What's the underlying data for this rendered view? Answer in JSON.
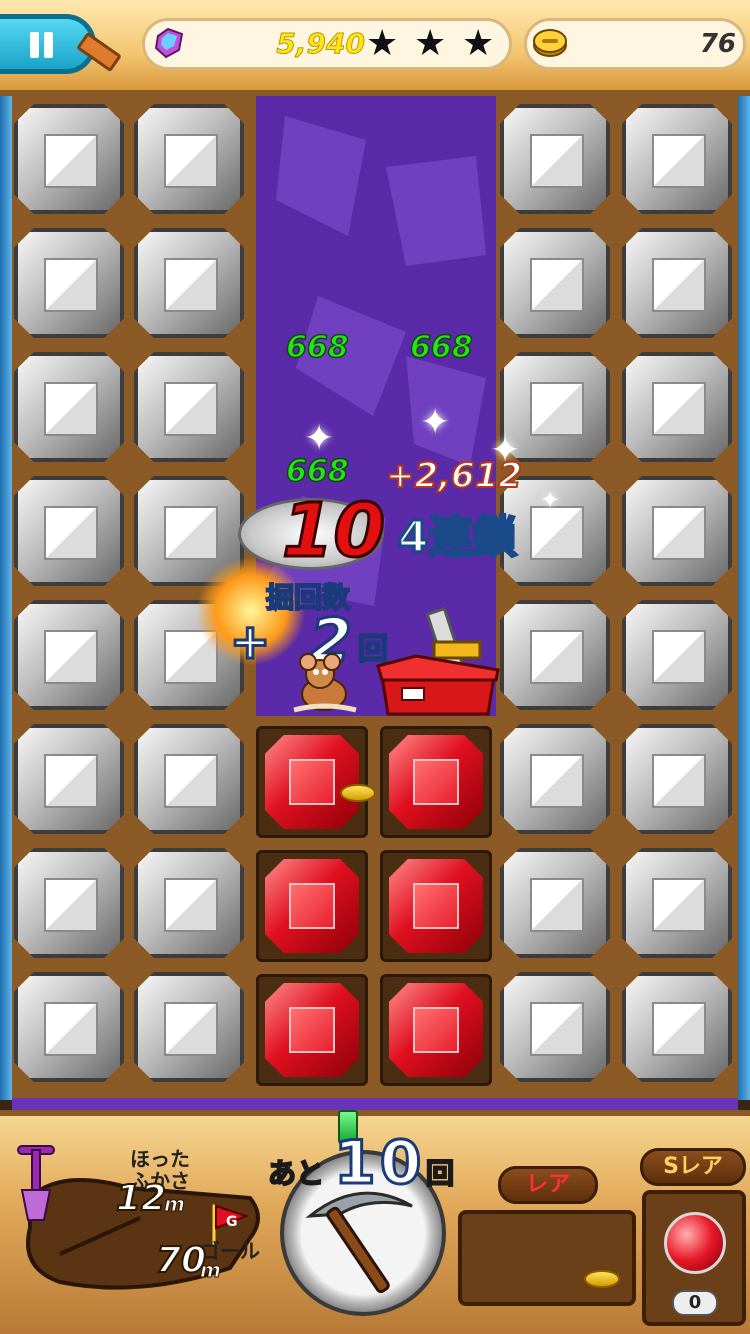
{
  "header": {
    "score": "5,940",
    "stars": [
      "★",
      "★",
      "★"
    ],
    "coins": "76"
  },
  "colors": {
    "score_yellow": "#ffe41a",
    "ruby_red": "#e01020",
    "rock_gray": "#bdbdbd",
    "shaft_purple": "#5a2aa8",
    "damage_green": "#2ae020"
  },
  "effects": {
    "damage_numbers": [
      "668",
      "668",
      "668"
    ],
    "bonus_score": "+2,612",
    "combo_count": "10",
    "chain_text": "4連鎖",
    "dig_bonus_label": "掘回数",
    "dig_bonus_plus": "+",
    "dig_bonus_count": "2",
    "dig_bonus_unit": "回"
  },
  "board": {
    "rows": 8,
    "left_rock_columns": 2,
    "right_rock_columns": 2,
    "ruby_grid": {
      "rows": 3,
      "cols": 2
    },
    "icons": [
      "rock-block-icon",
      "ruby-block-icon",
      "coin-icon",
      "sparkle-icon",
      "toolbox-icon",
      "mouse-character-icon"
    ]
  },
  "hud": {
    "depth_label": "ほった\nふかさ",
    "depth_value": "12",
    "depth_unit": "m",
    "goal_label": "ゴール",
    "goal_flag_letter": "G",
    "goal_value": "70",
    "goal_unit": "m",
    "remaining_prefix": "あと",
    "remaining_value": "10",
    "remaining_suffix": "回",
    "rare_label": "レア",
    "super_rare_label": "Sレア",
    "super_rare_count": "0"
  }
}
